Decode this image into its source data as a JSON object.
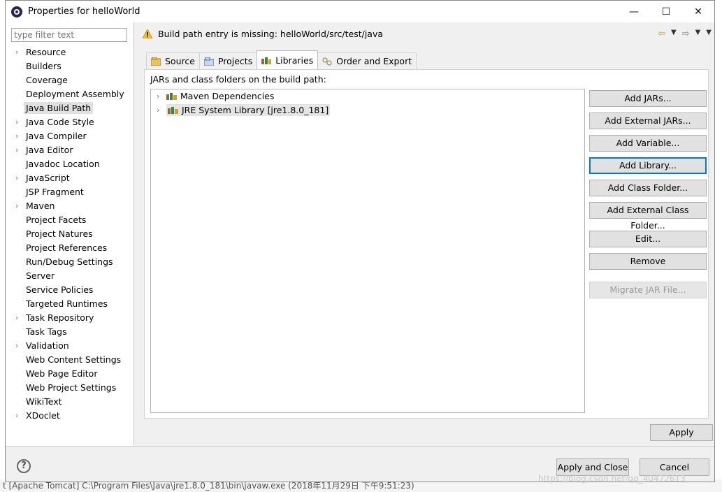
{
  "window": {
    "title": "Properties for helloWorld",
    "minimize": "—",
    "maximize": "☐",
    "close": "✕"
  },
  "filter": {
    "placeholder": "type filter text"
  },
  "sidebar": {
    "items": [
      {
        "label": "Resource",
        "expandable": true
      },
      {
        "label": "Builders",
        "expandable": false
      },
      {
        "label": "Coverage",
        "expandable": false
      },
      {
        "label": "Deployment Assembly",
        "expandable": false
      },
      {
        "label": "Java Build Path",
        "expandable": false,
        "selected": true
      },
      {
        "label": "Java Code Style",
        "expandable": true
      },
      {
        "label": "Java Compiler",
        "expandable": true
      },
      {
        "label": "Java Editor",
        "expandable": true
      },
      {
        "label": "Javadoc Location",
        "expandable": false
      },
      {
        "label": "JavaScript",
        "expandable": true
      },
      {
        "label": "JSP Fragment",
        "expandable": false
      },
      {
        "label": "Maven",
        "expandable": true
      },
      {
        "label": "Project Facets",
        "expandable": false
      },
      {
        "label": "Project Natures",
        "expandable": false
      },
      {
        "label": "Project References",
        "expandable": false
      },
      {
        "label": "Run/Debug Settings",
        "expandable": false
      },
      {
        "label": "Server",
        "expandable": false
      },
      {
        "label": "Service Policies",
        "expandable": false
      },
      {
        "label": "Targeted Runtimes",
        "expandable": false
      },
      {
        "label": "Task Repository",
        "expandable": true
      },
      {
        "label": "Task Tags",
        "expandable": false
      },
      {
        "label": "Validation",
        "expandable": true
      },
      {
        "label": "Web Content Settings",
        "expandable": false
      },
      {
        "label": "Web Page Editor",
        "expandable": false
      },
      {
        "label": "Web Project Settings",
        "expandable": false
      },
      {
        "label": "WikiText",
        "expandable": false
      },
      {
        "label": "XDoclet",
        "expandable": true
      }
    ]
  },
  "message": "Build path entry is missing: helloWorld/src/test/java",
  "tabs": [
    {
      "label": "Source"
    },
    {
      "label": "Projects"
    },
    {
      "label": "Libraries",
      "active": true
    },
    {
      "label": "Order and Export"
    }
  ],
  "panel": {
    "label": "JARs and class folders on the build path:",
    "libraries": [
      {
        "label": "Maven Dependencies"
      },
      {
        "label": "JRE System Library [jre1.8.0_181]",
        "selected": true
      }
    ]
  },
  "buttons": {
    "add_jars": "Add JARs...",
    "add_external_jars": "Add External JARs...",
    "add_variable": "Add Variable...",
    "add_library": "Add Library...",
    "add_class_folder": "Add Class Folder...",
    "add_external_class_folder": "Add External Class Folder...",
    "edit": "Edit...",
    "remove": "Remove",
    "migrate_jar": "Migrate JAR File...",
    "apply": "Apply",
    "apply_and_close": "Apply and Close",
    "cancel": "Cancel"
  },
  "help": "?",
  "background": {
    "console_text": "t [Apache Tomcat] C:\\Program Files\\Java\\jre1.8.0_181\\bin\\javaw.exe (2018年11月29日 下午9:51:23)",
    "watermark": "https://blog.csdn.net/qq_40472613"
  }
}
